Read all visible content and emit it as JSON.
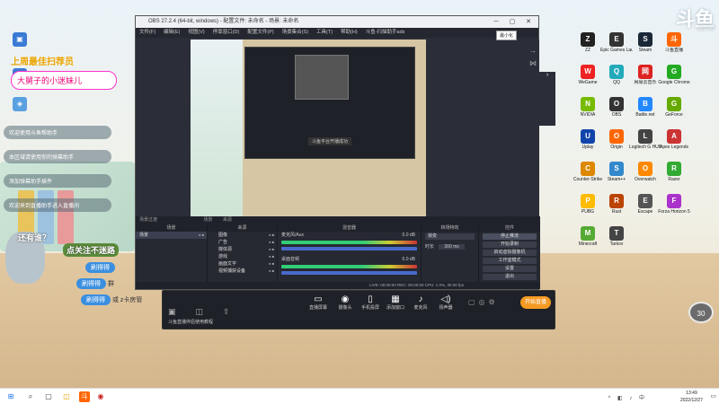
{
  "watermark": {
    "logo": "斗鱼",
    "room": "997757"
  },
  "banner": {
    "line1": "上周最佳扫荐员",
    "line2": "大舅子的小迷妹儿"
  },
  "chat_list": [
    "欢迎使用斗鱼帮助手",
    "本区域请使用你的弹幕助手",
    "添加弹幕助手插件",
    "欢迎来到直播助手进入直播间"
  ],
  "promo": {
    "line1": "还有谁？",
    "line2": "点关注不迷路",
    "badges": [
      "刷得得",
      "刷得得",
      "刷得得"
    ],
    "suffix": "或 z卡房管",
    "suffix2": "群"
  },
  "obs": {
    "title": "OBS 27.2.4 (64-bit, windows) - 配置文件: 未命名 - 场景: 未命名",
    "menu": [
      "文件(F)",
      "编辑(E)",
      "视图(V)",
      "停靠窗口(D)",
      "配置文件(P)",
      "场景集合(S)",
      "工具(T)",
      "帮助(H)",
      "斗鱼-扫描助手ads"
    ],
    "tooltip": "最小化",
    "dock_tabs": [
      "场景过渡",
      "场景",
      "来源"
    ],
    "docks": {
      "scenes": {
        "header": "场景",
        "item": "场景"
      },
      "sources": {
        "header": "来源",
        "items": [
          "图像",
          "广告",
          "媒体源",
          "游戏",
          "画面文字",
          "视频捕获设备"
        ]
      },
      "mixer": {
        "header": "混音器",
        "channels": [
          {
            "name": "麦克风/Aux",
            "db": "0.0 dB"
          },
          {
            "name": "桌面音频",
            "db": "0.0 dB"
          }
        ]
      },
      "transitions": {
        "header": "转场特效",
        "fade": "渐变",
        "duration_label": "时长",
        "duration": "300 ms"
      },
      "controls": {
        "header": "控件",
        "buttons": [
          "停止推流",
          "开始录制",
          "启动虚拟摄像机",
          "工作室模式",
          "设置",
          "退出"
        ]
      }
    },
    "status": "LIVE: 00:00:00   REC: 00:00:00   CPU: 1.0%, 30.00 fps",
    "inner_label": "斗鱼平台开播成功"
  },
  "toolbar": {
    "items": [
      {
        "icon": "monitor-icon",
        "label": "直播屏幕"
      },
      {
        "icon": "camera-icon",
        "label": "摄像头"
      },
      {
        "icon": "phone-icon",
        "label": "手机投屏"
      },
      {
        "icon": "window-icon",
        "label": "添加窗口"
      },
      {
        "icon": "mic-icon",
        "label": "麦克风"
      },
      {
        "icon": "speaker-icon",
        "label": "扬声器"
      }
    ],
    "go_live": "开始直播",
    "bottom_text": "斗鱼直播伴侣使用教程"
  },
  "desktop_icons": [
    {
      "label": "ZZ",
      "color": "#222"
    },
    {
      "label": "Epic Games Launcher",
      "color": "#333"
    },
    {
      "label": "Steam",
      "color": "#1b2838"
    },
    {
      "label": "斗鱼直播",
      "color": "#f60"
    },
    {
      "label": "WeGame",
      "color": "#e22"
    },
    {
      "label": "QQ",
      "color": "#2ab"
    },
    {
      "label": "网易云音乐",
      "color": "#d22"
    },
    {
      "label": "Google Chrome",
      "color": "#2a2"
    },
    {
      "label": "NVIDIA",
      "color": "#7b0"
    },
    {
      "label": "OBS",
      "color": "#333"
    },
    {
      "label": "Battle.net",
      "color": "#28f"
    },
    {
      "label": "GeForce",
      "color": "#6a0"
    },
    {
      "label": "Uplay",
      "color": "#14a"
    },
    {
      "label": "Origin",
      "color": "#f60"
    },
    {
      "label": "Logitech G HUB",
      "color": "#444"
    },
    {
      "label": "Apex Legends",
      "color": "#c33"
    },
    {
      "label": "Counter-Strike",
      "color": "#d80"
    },
    {
      "label": "Steam++",
      "color": "#38c"
    },
    {
      "label": "Overwatch",
      "color": "#f80"
    },
    {
      "label": "Razer",
      "color": "#3a3"
    },
    {
      "label": "PUBG",
      "color": "#fb0"
    },
    {
      "label": "Rust",
      "color": "#b40"
    },
    {
      "label": "Escape",
      "color": "#555"
    },
    {
      "label": "Forza Horizon 5",
      "color": "#a3c"
    },
    {
      "label": "Minecraft",
      "color": "#5a3"
    },
    {
      "label": "Tarkov",
      "color": "#444"
    }
  ],
  "gauge": "30",
  "taskbar": {
    "apps": [
      "⊞",
      "⌕",
      "▢",
      "◫",
      "斗",
      "◉"
    ],
    "time": "13:49",
    "date": "2022/12/27",
    "sys": "^ ◧ ♪ 中"
  }
}
